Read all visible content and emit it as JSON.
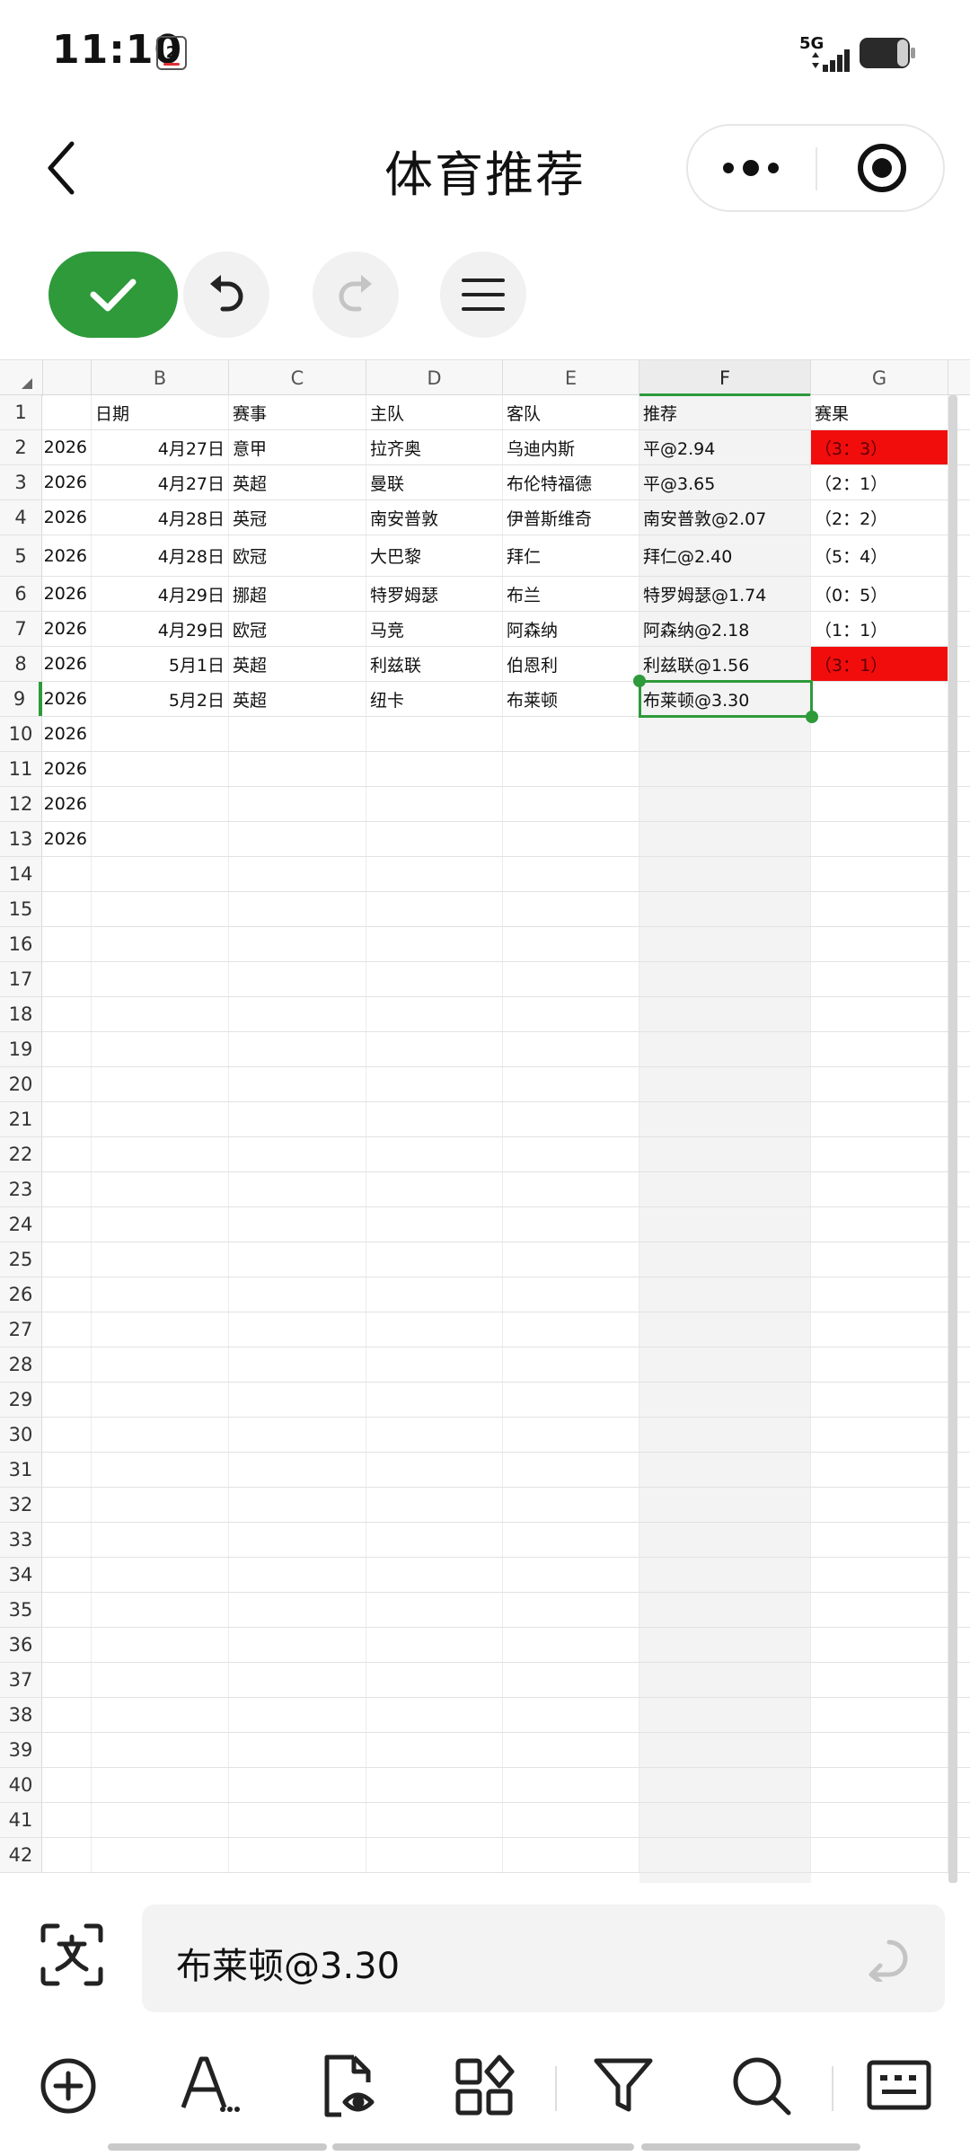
{
  "status": {
    "time": "11:10",
    "calendar_day": "2",
    "network": "5G"
  },
  "title_bar": {
    "title": "体育推荐"
  },
  "columns": [
    "B",
    "C",
    "D",
    "E",
    "F",
    "G"
  ],
  "row_numbers": [
    "1",
    "2",
    "3",
    "4",
    "5",
    "6",
    "7",
    "8",
    "9",
    "10",
    "11",
    "12",
    "13",
    "14",
    "15",
    "16",
    "17",
    "18",
    "19",
    "20",
    "21",
    "22",
    "23",
    "24",
    "25",
    "26",
    "27",
    "28",
    "29",
    "30",
    "31",
    "32",
    "33",
    "34",
    "35",
    "36",
    "37",
    "38",
    "39",
    "40",
    "41",
    "42"
  ],
  "headers": {
    "date": "日期",
    "league": "赛事",
    "home": "主队",
    "away": "客队",
    "pick": "推荐",
    "result": "赛果"
  },
  "rows": [
    {
      "year": "2026",
      "date": "4月27日",
      "league": "意甲",
      "home": "拉齐奥",
      "away": "乌迪内斯",
      "pick": "平@2.94",
      "result": "（3：3）",
      "result_highlight": true
    },
    {
      "year": "2026",
      "date": "4月27日",
      "league": "英超",
      "home": "曼联",
      "away": "布伦特福德",
      "pick": "平@3.65",
      "result": "（2：1）",
      "result_highlight": false
    },
    {
      "year": "2026",
      "date": "4月28日",
      "league": "英冠",
      "home": "南安普敦",
      "away": "伊普斯维奇",
      "pick": "南安普敦@2.07",
      "result": "（2：2）",
      "result_highlight": false
    },
    {
      "year": "2026",
      "date": "4月28日",
      "league": "欧冠",
      "home": "大巴黎",
      "away": "拜仁",
      "pick": "拜仁@2.40",
      "result": "（5：4）",
      "result_highlight": false
    },
    {
      "year": "2026",
      "date": "4月29日",
      "league": "挪超",
      "home": "特罗姆瑟",
      "away": "布兰",
      "pick": "特罗姆瑟@1.74",
      "result": "（0：5）",
      "result_highlight": false
    },
    {
      "year": "2026",
      "date": "4月29日",
      "league": "欧冠",
      "home": "马竞",
      "away": "阿森纳",
      "pick": "阿森纳@2.18",
      "result": "（1：1）",
      "result_highlight": false
    },
    {
      "year": "2026",
      "date": "5月1日",
      "league": "英超",
      "home": "利兹联",
      "away": "伯恩利",
      "pick": "利兹联@1.56",
      "result": "（3：1）",
      "result_highlight": true
    },
    {
      "year": "2026",
      "date": "5月2日",
      "league": "英超",
      "home": "纽卡",
      "away": "布莱顿",
      "pick": "布莱顿@3.30",
      "result": "",
      "result_highlight": false
    },
    {
      "year": "2026",
      "date": "",
      "league": "",
      "home": "",
      "away": "",
      "pick": "",
      "result": "",
      "result_highlight": false
    },
    {
      "year": "2026",
      "date": "",
      "league": "",
      "home": "",
      "away": "",
      "pick": "",
      "result": "",
      "result_highlight": false
    },
    {
      "year": "2026",
      "date": "",
      "league": "",
      "home": "",
      "away": "",
      "pick": "",
      "result": "",
      "result_highlight": false
    },
    {
      "year": "2026",
      "date": "",
      "league": "",
      "home": "",
      "away": "",
      "pick": "",
      "result": "",
      "result_highlight": false
    }
  ],
  "selection": {
    "column": "F",
    "row": "9"
  },
  "formula_bar": {
    "value": "布莱顿@3.30"
  },
  "icons": {
    "back": "chevron-left-icon",
    "more": "more-dots-icon",
    "target": "target-icon",
    "confirm": "check-icon",
    "undo": "undo-icon",
    "redo": "redo-icon",
    "menu": "hamburger-icon",
    "scan": "text-scan-icon",
    "enter": "enter-icon",
    "insert": "plus-circle-icon",
    "font": "font-format-icon",
    "view": "file-preview-icon",
    "apps": "apps-icon",
    "filter": "filter-icon",
    "search": "search-icon",
    "keyboard": "keyboard-icon"
  },
  "colors": {
    "accent": "#2e9a3a",
    "highlight": "#f20d0d"
  }
}
